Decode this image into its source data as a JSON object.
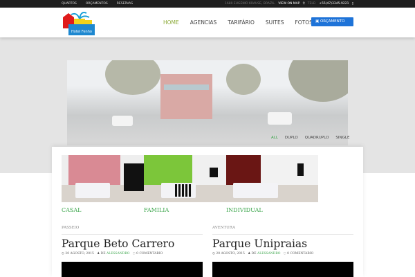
{
  "topbar": {
    "links": [
      "QUARTOS",
      "ORÇAMENTOS",
      "RESERVAS"
    ],
    "address": "1680 EUGENIO KRAUSE, BRAZIL.",
    "map_link": "VIEW ON MAP",
    "tel_label": "TELE:",
    "tel": "+55(47)3345-9221"
  },
  "logo": {
    "text": "Hotel Fenho"
  },
  "nav": {
    "items": [
      "HOME",
      "AGENCIAS",
      "TARIFÁRIO",
      "SUITES",
      "FOTOS"
    ],
    "button": "ORÇAMENTO"
  },
  "filters": [
    "ALL",
    "DUPLO",
    "QUADRUPLO",
    "SINGLE"
  ],
  "rooms": [
    {
      "label": "CASAL",
      "wall": "#d98a94"
    },
    {
      "label": "FAMILIA",
      "wall": "#7cc63a"
    },
    {
      "label": "INDIVIDUAL",
      "wall": "#6a1614"
    }
  ],
  "posts": [
    {
      "category": "PASSEIO",
      "title": "Parque Beto Carrero",
      "date": "20 AGOSTO, 2015",
      "by": "DE",
      "author": "ALESSANDRO",
      "comments": "0 COMENTARIO"
    },
    {
      "category": "AVENTURA",
      "title": "Parque Unipraias",
      "date": "20 AGOSTO, 2015",
      "by": "DE",
      "author": "ALESSANDRO",
      "comments": "0 COMENTARIO"
    }
  ],
  "colors": {
    "accent": "#3aa54a",
    "button": "#1e73d8",
    "nav_active": "#8dab3a"
  }
}
